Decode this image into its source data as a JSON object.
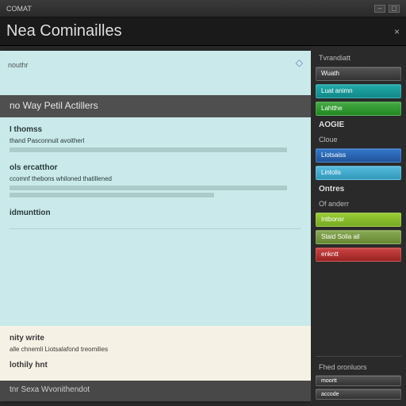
{
  "titlebar": {
    "app_name": "COMAT"
  },
  "header": {
    "title": "Nea Cominailles",
    "close_label": "×"
  },
  "doc": {
    "tab_label": "nouthr",
    "bar_title": "no Way Petil Actillers",
    "sections": [
      {
        "heading": "I thomss",
        "sub": "thand Pasconnuit avoitherl"
      },
      {
        "heading": "ols ercatthor",
        "sub": "ccomnf thebons whiloned thatillened"
      },
      {
        "heading": "idmunttion"
      }
    ],
    "lower": {
      "heading1": "nity write",
      "sub1": "alle chnemli Liotsalafond treomilies",
      "heading2": "lothily hnt"
    },
    "footer": "tnr Sexa Wvonithendot"
  },
  "sidebar": {
    "section1": "Tvrandiatt",
    "items1": [
      "Wuath",
      "Luat animn",
      "Lahtthe"
    ],
    "section2": "AOGIE",
    "sub2": "Cloue",
    "items2": [
      "Liotsaiss",
      "Lintolis"
    ],
    "section3": "Ontres",
    "sub3": "Of anderr",
    "items3": [
      "Intbonsr",
      "Staid Solia ail",
      "enkntt"
    ],
    "footer_label": "Fhed oronluors",
    "footer_btns": [
      "moortt",
      "accode"
    ]
  }
}
